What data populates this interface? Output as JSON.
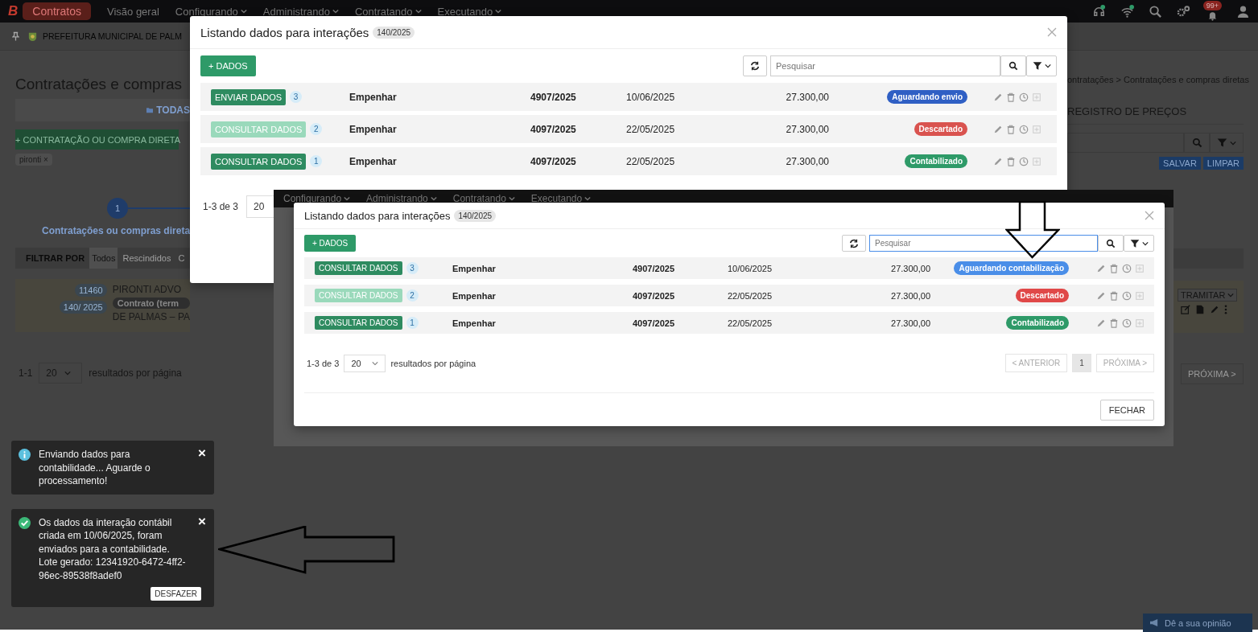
{
  "top_nav": {
    "logo": "B",
    "app": "Contratos",
    "items": [
      {
        "label": "Visão geral",
        "dropdown": false
      },
      {
        "label": "Configurando",
        "dropdown": true
      },
      {
        "label": "Administrando",
        "dropdown": true
      },
      {
        "label": "Contratando",
        "dropdown": true
      },
      {
        "label": "Executando",
        "dropdown": true
      }
    ],
    "notification_count": "99+"
  },
  "org_bar": {
    "name": "PREFEITURA MUNICIPAL DE PALM"
  },
  "page_left": {
    "title": "Contratações e compras",
    "folder_tab": "TODAS",
    "new_button": "+ CONTRATAÇÃO OU COMPRA DIRETA",
    "filter_chip": "pironti",
    "chip_close": "×",
    "step_number": "1",
    "step_label": "Contratações ou compras direta",
    "filter_label": "FILTRAR POR",
    "filters": [
      {
        "label": "Todos",
        "selected": true
      },
      {
        "label": "Rescindidos",
        "selected": false
      },
      {
        "label": "C",
        "selected": false
      }
    ],
    "card": {
      "code": "11460",
      "number": "140/ 2025",
      "name": "PIRONTI ADVO",
      "type": "Contrato (term",
      "place": "DE PALMAS – PA"
    },
    "range": "1-1",
    "page_size": "20",
    "per_page_label": "resultados por página"
  },
  "page_right": {
    "breadcrumb": "ontratações > Contratações e compras diretas",
    "tab": "REGISTRO DE PREÇOS",
    "save_button": "SALVAR",
    "clear_button": "LIMPAR",
    "route_button": "TRAMITAR",
    "next_button": "PRÓXIMA >",
    "feedback_button": "Dê a sua opinião"
  },
  "modals": [
    {
      "title": "Listando dados para interações",
      "badge": "140/2025",
      "add_button": "+ DADOS",
      "search": {
        "placeholder": "Pesquisar",
        "focused": false
      },
      "rows": [
        {
          "action": "ENVIAR DADOS",
          "disabled": false,
          "count": "3",
          "type": "Empenhar",
          "number": "4907/2025",
          "date": "10/06/2025",
          "value": "27.300,00",
          "status": "Aguardando envio",
          "color": "#2f5fc4"
        },
        {
          "action": "CONSULTAR DADOS",
          "disabled": true,
          "count": "2",
          "type": "Empenhar",
          "number": "4097/2025",
          "date": "22/05/2025",
          "value": "27.300,00",
          "status": "Descartado",
          "color": "#d9534f"
        },
        {
          "action": "CONSULTAR DADOS",
          "disabled": false,
          "count": "1",
          "type": "Empenhar",
          "number": "4097/2025",
          "date": "22/05/2025",
          "value": "27.300,00",
          "status": "Contabilizado",
          "color": "#2e9a68"
        }
      ],
      "range": "1-3 de 3",
      "page_size": "20"
    }
  ],
  "pasted_screenshot": {
    "nav_items": [
      "Configurando",
      "Administrando",
      "Contratando",
      "Executando"
    ],
    "modal": {
      "title": "Listando dados para interações",
      "badge": "140/2025",
      "add_button": "+ DADOS",
      "search": {
        "placeholder": "Pesquisar",
        "focused": true
      },
      "rows": [
        {
          "action": "CONSULTAR DADOS",
          "disabled": false,
          "count": "3",
          "type": "Empenhar",
          "number": "4907/2025",
          "date": "10/06/2025",
          "value": "27.300,00",
          "status": "Aguardando contabilização",
          "color": "#4a8ee8"
        },
        {
          "action": "CONSULTAR DADOS",
          "disabled": true,
          "count": "2",
          "type": "Empenhar",
          "number": "4097/2025",
          "date": "22/05/2025",
          "value": "27.300,00",
          "status": "Descartado",
          "color": "#e04848"
        },
        {
          "action": "CONSULTAR DADOS",
          "disabled": false,
          "count": "1",
          "type": "Empenhar",
          "number": "4097/2025",
          "date": "22/05/2025",
          "value": "27.300,00",
          "status": "Contabilizado",
          "color": "#2e9a68"
        }
      ],
      "range": "1-3 de 3",
      "page_size": "20",
      "per_page_label": "resultados por página",
      "prev_button": "< ANTERIOR",
      "page": "1",
      "next_button": "PRÓXIMA >",
      "close_button": "FECHAR"
    }
  },
  "toasts": [
    {
      "kind": "info",
      "message": "Enviando dados para contabilidade... Aguarde o processamento!",
      "close": "×"
    },
    {
      "kind": "success",
      "message": "Os dados da interação contábil criada em 10/06/2025, foram enviados para a contabilidade. Lote gerado: 12341920-6472-4ff2-96ec-89538f8adef0",
      "close": "×",
      "action": "DESFAZER"
    }
  ]
}
